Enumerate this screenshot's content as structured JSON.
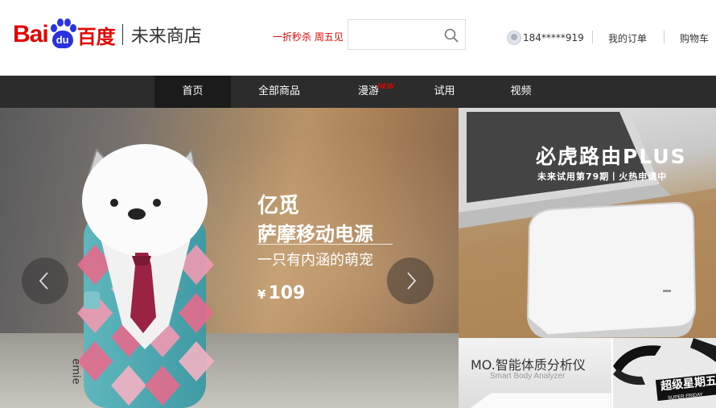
{
  "header": {
    "logo_bai": "Bai",
    "logo_du": "du",
    "logo_cn": "百度",
    "logo_sub": "未来商店",
    "promo": "一折秒杀 周五见",
    "search_placeholder": "",
    "user_phone": "184*****919",
    "my_orders": "我的订单",
    "cart": "购物车"
  },
  "nav": {
    "items": [
      {
        "label": "首页",
        "active": true
      },
      {
        "label": "全部商品"
      },
      {
        "label": "漫游",
        "badge": "NEW"
      },
      {
        "label": "试用"
      },
      {
        "label": "视频"
      }
    ]
  },
  "banner": {
    "brand": "亿觅",
    "product": "萨摩移动电源",
    "tagline": "一只有内涵的萌宠",
    "currency": "¥",
    "price": "109",
    "bottle_label": "emie"
  },
  "promo_right_top": {
    "title": "必虎路由PLUS",
    "subtitle": "未来试用第79期丨火热申请中"
  },
  "promo_right_bottom_left": {
    "title": "MO.智能体质分析仪",
    "subtitle": "Smart Body Analyzer"
  },
  "promo_right_bottom_right": {
    "badge": "超级星期五",
    "badge_sub": "SUPER FRIDAY"
  },
  "colors": {
    "brand_red": "#e10602",
    "brand_blue": "#2932e1",
    "nav_bg": "#2c2c2c"
  }
}
